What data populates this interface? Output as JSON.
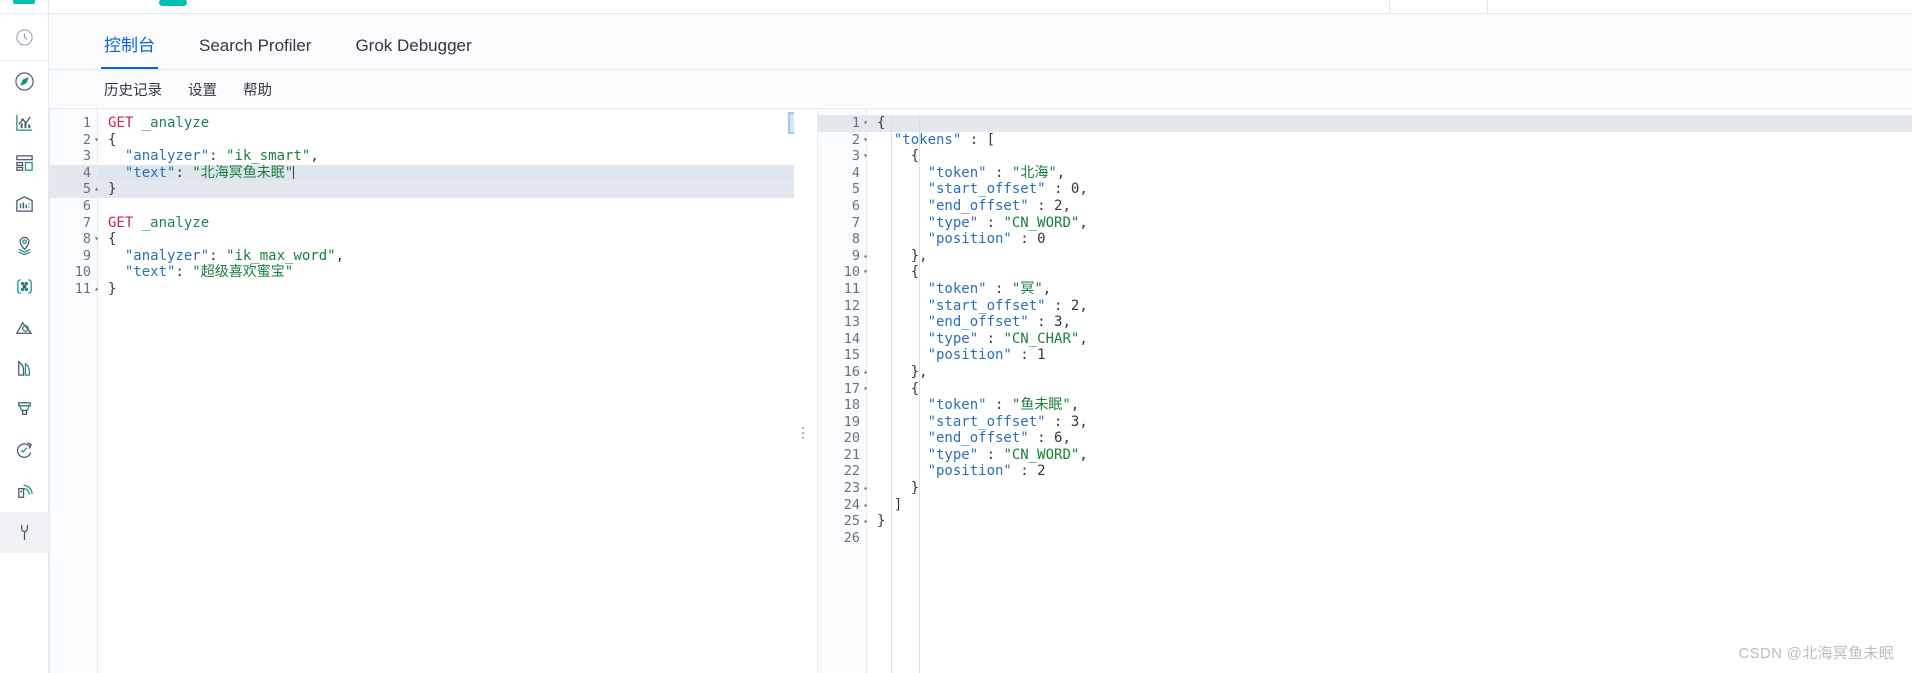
{
  "app": {
    "brand_color": "#00bfb3",
    "accent_color": "#0b64dd"
  },
  "sidebar": {
    "items": [
      {
        "name": "recently-viewed-icon",
        "label": "Recently viewed"
      },
      {
        "name": "discover-icon",
        "label": "Discover"
      },
      {
        "name": "visualize-icon",
        "label": "Visualize"
      },
      {
        "name": "dashboard-icon",
        "label": "Dashboard"
      },
      {
        "name": "canvas-icon",
        "label": "Canvas"
      },
      {
        "name": "maps-icon",
        "label": "Maps"
      },
      {
        "name": "machine-learning-icon",
        "label": "Machine Learning"
      },
      {
        "name": "infrastructure-icon",
        "label": "Infrastructure"
      },
      {
        "name": "logs-icon",
        "label": "Logs"
      },
      {
        "name": "apm-icon",
        "label": "APM"
      },
      {
        "name": "uptime-icon",
        "label": "Uptime"
      },
      {
        "name": "siem-icon",
        "label": "SIEM"
      },
      {
        "name": "dev-tools-icon",
        "label": "Dev Tools"
      }
    ]
  },
  "tabs": [
    {
      "label": "控制台",
      "active": true
    },
    {
      "label": "Search Profiler",
      "active": false
    },
    {
      "label": "Grok Debugger",
      "active": false
    }
  ],
  "submenu": [
    {
      "label": "历史记录"
    },
    {
      "label": "设置"
    },
    {
      "label": "帮助"
    }
  ],
  "editor": {
    "request_lines": [
      {
        "n": "1",
        "fold": "",
        "hl": false,
        "tokens": [
          {
            "t": "GET ",
            "c": "k-method"
          },
          {
            "t": "_analyze",
            "c": "k-url"
          }
        ]
      },
      {
        "n": "2",
        "fold": "▾",
        "hl": false,
        "tokens": [
          {
            "t": "{",
            "c": "k-punct"
          }
        ]
      },
      {
        "n": "3",
        "fold": "",
        "hl": false,
        "tokens": [
          {
            "t": "  ",
            "c": "k-punct"
          },
          {
            "t": "\"analyzer\"",
            "c": "k-key"
          },
          {
            "t": ": ",
            "c": "k-punct"
          },
          {
            "t": "\"ik_smart\"",
            "c": "k-str"
          },
          {
            "t": ",",
            "c": "k-punct"
          }
        ]
      },
      {
        "n": "4",
        "fold": "",
        "hl": true,
        "cursor": true,
        "tokens": [
          {
            "t": "  ",
            "c": "k-punct"
          },
          {
            "t": "\"text\"",
            "c": "k-key"
          },
          {
            "t": ": ",
            "c": "k-punct"
          },
          {
            "t": "\"北海冥鱼未眠\"",
            "c": "k-str"
          }
        ]
      },
      {
        "n": "5",
        "fold": "▴",
        "hl": true,
        "tokens": [
          {
            "t": "}",
            "c": "k-punct"
          }
        ]
      },
      {
        "n": "6",
        "fold": "",
        "hl": false,
        "tokens": [
          {
            "t": "",
            "c": "k-punct"
          }
        ]
      },
      {
        "n": "7",
        "fold": "",
        "hl": false,
        "tokens": [
          {
            "t": "GET ",
            "c": "k-method"
          },
          {
            "t": "_analyze",
            "c": "k-url"
          }
        ]
      },
      {
        "n": "8",
        "fold": "▾",
        "hl": false,
        "tokens": [
          {
            "t": "{",
            "c": "k-punct"
          }
        ]
      },
      {
        "n": "9",
        "fold": "",
        "hl": false,
        "tokens": [
          {
            "t": "  ",
            "c": "k-punct"
          },
          {
            "t": "\"analyzer\"",
            "c": "k-key"
          },
          {
            "t": ": ",
            "c": "k-punct"
          },
          {
            "t": "\"ik_max_word\"",
            "c": "k-str"
          },
          {
            "t": ",",
            "c": "k-punct"
          }
        ]
      },
      {
        "n": "10",
        "fold": "",
        "hl": false,
        "tokens": [
          {
            "t": "  ",
            "c": "k-punct"
          },
          {
            "t": "\"text\"",
            "c": "k-key"
          },
          {
            "t": ": ",
            "c": "k-punct"
          },
          {
            "t": "\"超级喜欢蜜宝\"",
            "c": "k-str"
          }
        ]
      },
      {
        "n": "11",
        "fold": "▴",
        "hl": false,
        "tokens": [
          {
            "t": "}",
            "c": "k-punct"
          }
        ]
      }
    ],
    "play_button_label": "send-request",
    "wrench_button_label": "request-options"
  },
  "response": {
    "lines": [
      {
        "n": "1",
        "fold": "▾",
        "hl": true,
        "tokens": [
          {
            "t": "{",
            "c": "k-punct"
          }
        ]
      },
      {
        "n": "2",
        "fold": "▾",
        "hl": false,
        "tokens": [
          {
            "t": "  ",
            "c": "k-punct"
          },
          {
            "t": "\"tokens\"",
            "c": "k-key"
          },
          {
            "t": " : ",
            "c": "k-punct"
          },
          {
            "t": "[",
            "c": "k-punct"
          }
        ]
      },
      {
        "n": "3",
        "fold": "▾",
        "hl": false,
        "tokens": [
          {
            "t": "    ",
            "c": "k-punct"
          },
          {
            "t": "{",
            "c": "k-punct"
          }
        ]
      },
      {
        "n": "4",
        "fold": "",
        "hl": false,
        "tokens": [
          {
            "t": "      ",
            "c": "k-punct"
          },
          {
            "t": "\"token\"",
            "c": "k-key"
          },
          {
            "t": " : ",
            "c": "k-punct"
          },
          {
            "t": "\"北海\"",
            "c": "k-str"
          },
          {
            "t": ",",
            "c": "k-punct"
          }
        ]
      },
      {
        "n": "5",
        "fold": "",
        "hl": false,
        "tokens": [
          {
            "t": "      ",
            "c": "k-punct"
          },
          {
            "t": "\"start_offset\"",
            "c": "k-key"
          },
          {
            "t": " : ",
            "c": "k-punct"
          },
          {
            "t": "0",
            "c": "k-num"
          },
          {
            "t": ",",
            "c": "k-punct"
          }
        ]
      },
      {
        "n": "6",
        "fold": "",
        "hl": false,
        "tokens": [
          {
            "t": "      ",
            "c": "k-punct"
          },
          {
            "t": "\"end_offset\"",
            "c": "k-key"
          },
          {
            "t": " : ",
            "c": "k-punct"
          },
          {
            "t": "2",
            "c": "k-num"
          },
          {
            "t": ",",
            "c": "k-punct"
          }
        ]
      },
      {
        "n": "7",
        "fold": "",
        "hl": false,
        "tokens": [
          {
            "t": "      ",
            "c": "k-punct"
          },
          {
            "t": "\"type\"",
            "c": "k-key"
          },
          {
            "t": " : ",
            "c": "k-punct"
          },
          {
            "t": "\"CN_WORD\"",
            "c": "k-str"
          },
          {
            "t": ",",
            "c": "k-punct"
          }
        ]
      },
      {
        "n": "8",
        "fold": "",
        "hl": false,
        "tokens": [
          {
            "t": "      ",
            "c": "k-punct"
          },
          {
            "t": "\"position\"",
            "c": "k-key"
          },
          {
            "t": " : ",
            "c": "k-punct"
          },
          {
            "t": "0",
            "c": "k-num"
          }
        ]
      },
      {
        "n": "9",
        "fold": "▴",
        "hl": false,
        "tokens": [
          {
            "t": "    ",
            "c": "k-punct"
          },
          {
            "t": "},",
            "c": "k-punct"
          }
        ]
      },
      {
        "n": "10",
        "fold": "▾",
        "hl": false,
        "tokens": [
          {
            "t": "    ",
            "c": "k-punct"
          },
          {
            "t": "{",
            "c": "k-punct"
          }
        ]
      },
      {
        "n": "11",
        "fold": "",
        "hl": false,
        "tokens": [
          {
            "t": "      ",
            "c": "k-punct"
          },
          {
            "t": "\"token\"",
            "c": "k-key"
          },
          {
            "t": " : ",
            "c": "k-punct"
          },
          {
            "t": "\"冥\"",
            "c": "k-str"
          },
          {
            "t": ",",
            "c": "k-punct"
          }
        ]
      },
      {
        "n": "12",
        "fold": "",
        "hl": false,
        "tokens": [
          {
            "t": "      ",
            "c": "k-punct"
          },
          {
            "t": "\"start_offset\"",
            "c": "k-key"
          },
          {
            "t": " : ",
            "c": "k-punct"
          },
          {
            "t": "2",
            "c": "k-num"
          },
          {
            "t": ",",
            "c": "k-punct"
          }
        ]
      },
      {
        "n": "13",
        "fold": "",
        "hl": false,
        "tokens": [
          {
            "t": "      ",
            "c": "k-punct"
          },
          {
            "t": "\"end_offset\"",
            "c": "k-key"
          },
          {
            "t": " : ",
            "c": "k-punct"
          },
          {
            "t": "3",
            "c": "k-num"
          },
          {
            "t": ",",
            "c": "k-punct"
          }
        ]
      },
      {
        "n": "14",
        "fold": "",
        "hl": false,
        "tokens": [
          {
            "t": "      ",
            "c": "k-punct"
          },
          {
            "t": "\"type\"",
            "c": "k-key"
          },
          {
            "t": " : ",
            "c": "k-punct"
          },
          {
            "t": "\"CN_CHAR\"",
            "c": "k-str"
          },
          {
            "t": ",",
            "c": "k-punct"
          }
        ]
      },
      {
        "n": "15",
        "fold": "",
        "hl": false,
        "tokens": [
          {
            "t": "      ",
            "c": "k-punct"
          },
          {
            "t": "\"position\"",
            "c": "k-key"
          },
          {
            "t": " : ",
            "c": "k-punct"
          },
          {
            "t": "1",
            "c": "k-num"
          }
        ]
      },
      {
        "n": "16",
        "fold": "▴",
        "hl": false,
        "tokens": [
          {
            "t": "    ",
            "c": "k-punct"
          },
          {
            "t": "},",
            "c": "k-punct"
          }
        ]
      },
      {
        "n": "17",
        "fold": "▾",
        "hl": false,
        "tokens": [
          {
            "t": "    ",
            "c": "k-punct"
          },
          {
            "t": "{",
            "c": "k-punct"
          }
        ]
      },
      {
        "n": "18",
        "fold": "",
        "hl": false,
        "tokens": [
          {
            "t": "      ",
            "c": "k-punct"
          },
          {
            "t": "\"token\"",
            "c": "k-key"
          },
          {
            "t": " : ",
            "c": "k-punct"
          },
          {
            "t": "\"鱼未眠\"",
            "c": "k-str"
          },
          {
            "t": ",",
            "c": "k-punct"
          }
        ]
      },
      {
        "n": "19",
        "fold": "",
        "hl": false,
        "tokens": [
          {
            "t": "      ",
            "c": "k-punct"
          },
          {
            "t": "\"start_offset\"",
            "c": "k-key"
          },
          {
            "t": " : ",
            "c": "k-punct"
          },
          {
            "t": "3",
            "c": "k-num"
          },
          {
            "t": ",",
            "c": "k-punct"
          }
        ]
      },
      {
        "n": "20",
        "fold": "",
        "hl": false,
        "tokens": [
          {
            "t": "      ",
            "c": "k-punct"
          },
          {
            "t": "\"end_offset\"",
            "c": "k-key"
          },
          {
            "t": " : ",
            "c": "k-punct"
          },
          {
            "t": "6",
            "c": "k-num"
          },
          {
            "t": ",",
            "c": "k-punct"
          }
        ]
      },
      {
        "n": "21",
        "fold": "",
        "hl": false,
        "tokens": [
          {
            "t": "      ",
            "c": "k-punct"
          },
          {
            "t": "\"type\"",
            "c": "k-key"
          },
          {
            "t": " : ",
            "c": "k-punct"
          },
          {
            "t": "\"CN_WORD\"",
            "c": "k-str"
          },
          {
            "t": ",",
            "c": "k-punct"
          }
        ]
      },
      {
        "n": "22",
        "fold": "",
        "hl": false,
        "tokens": [
          {
            "t": "      ",
            "c": "k-punct"
          },
          {
            "t": "\"position\"",
            "c": "k-key"
          },
          {
            "t": " : ",
            "c": "k-punct"
          },
          {
            "t": "2",
            "c": "k-num"
          }
        ]
      },
      {
        "n": "23",
        "fold": "▴",
        "hl": false,
        "tokens": [
          {
            "t": "    ",
            "c": "k-punct"
          },
          {
            "t": "}",
            "c": "k-punct"
          }
        ]
      },
      {
        "n": "24",
        "fold": "▴",
        "hl": false,
        "tokens": [
          {
            "t": "  ",
            "c": "k-punct"
          },
          {
            "t": "]",
            "c": "k-punct"
          }
        ]
      },
      {
        "n": "25",
        "fold": "▴",
        "hl": false,
        "tokens": [
          {
            "t": "}",
            "c": "k-punct"
          }
        ]
      },
      {
        "n": "26",
        "fold": "",
        "hl": false,
        "tokens": [
          {
            "t": "",
            "c": "k-punct"
          }
        ]
      }
    ]
  },
  "watermark": {
    "text": "CSDN @北海冥鱼未眠"
  }
}
